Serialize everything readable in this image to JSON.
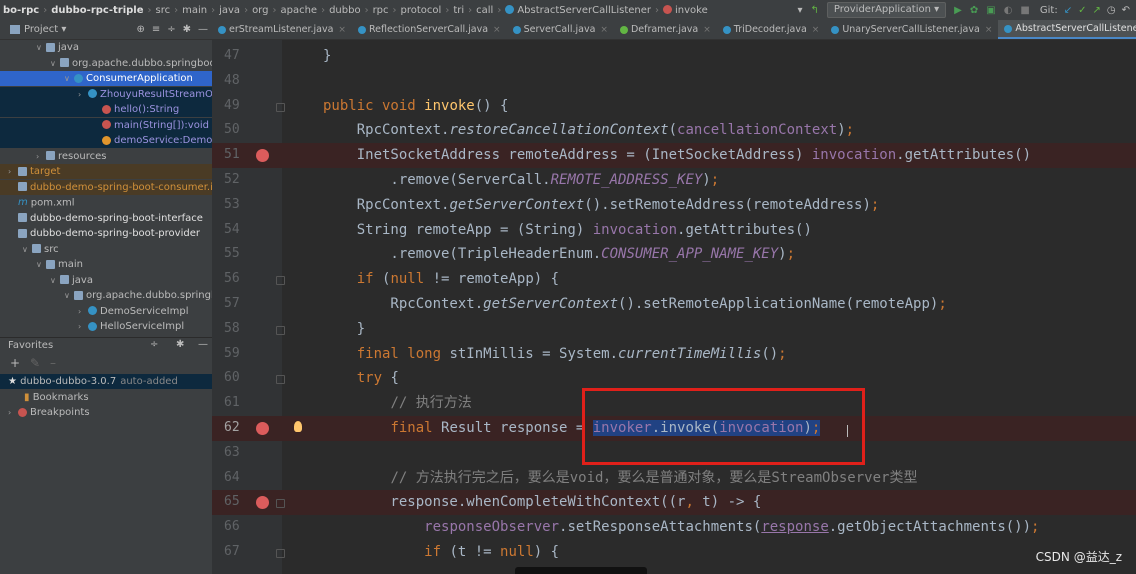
{
  "breadcrumb": [
    "bo-rpc",
    "dubbo-rpc-triple",
    "src",
    "main",
    "java",
    "org",
    "apache",
    "dubbo",
    "rpc",
    "protocol",
    "tri",
    "call",
    "AbstractServerCallListener",
    "invoke"
  ],
  "run_config": "ProviderApplication",
  "git_label": "Git:",
  "project_panel": {
    "label": "Project"
  },
  "tabs": [
    {
      "label": "erStreamListener.java",
      "color": "#3592c4",
      "active": false
    },
    {
      "label": "ReflectionServerCall.java",
      "color": "#3592c4",
      "active": false
    },
    {
      "label": "ServerCall.java",
      "color": "#3592c4",
      "active": false
    },
    {
      "label": "Deframer.java",
      "color": "#62b543",
      "active": false
    },
    {
      "label": "TriDecoder.java",
      "color": "#3592c4",
      "active": false
    },
    {
      "label": "UnaryServerCallListener.java",
      "color": "#3592c4",
      "active": false
    },
    {
      "label": "AbstractServerCallListener.java",
      "color": "#3592c4",
      "active": true
    }
  ],
  "tree": [
    {
      "label": "java",
      "indent": 36,
      "icon": "folder",
      "arrow": "v"
    },
    {
      "label": "org.apache.dubbo.springboo",
      "indent": 50,
      "icon": "folder",
      "arrow": "v"
    },
    {
      "label": "ConsumerApplication",
      "indent": 64,
      "icon": "class",
      "arrow": "v",
      "style": "selblue"
    },
    {
      "label": "ZhouyuResultStreamOb",
      "indent": 78,
      "icon": "class",
      "arrow": ">",
      "style": "sel"
    },
    {
      "label": "hello():String",
      "indent": 92,
      "icon": "red",
      "arrow": "",
      "style": "sel"
    },
    {
      "label": "main(String[]):void",
      "indent": 92,
      "icon": "red",
      "arrow": "",
      "style": "sel"
    },
    {
      "label": "demoService:DemoSen",
      "indent": 92,
      "icon": "orange",
      "arrow": "",
      "style": "sel"
    },
    {
      "label": "resources",
      "indent": 36,
      "icon": "folder",
      "arrow": ">"
    },
    {
      "label": "target",
      "indent": 8,
      "icon": "folder",
      "arrow": ">",
      "style": "orange"
    },
    {
      "label": "dubbo-demo-spring-boot-consumer.i",
      "indent": 8,
      "icon": "folder",
      "arrow": "",
      "style": "orange"
    },
    {
      "label": "pom.xml",
      "indent": 8,
      "icon": "pom",
      "arrow": ""
    },
    {
      "label": "dubbo-demo-spring-boot-interface",
      "indent": 8,
      "icon": "folder",
      "arrow": ""
    },
    {
      "label": "dubbo-demo-spring-boot-provider",
      "indent": 8,
      "icon": "folder",
      "arrow": ""
    },
    {
      "label": "src",
      "indent": 22,
      "icon": "folder",
      "arrow": "v"
    },
    {
      "label": "main",
      "indent": 36,
      "icon": "folder",
      "arrow": "v"
    },
    {
      "label": "java",
      "indent": 50,
      "icon": "folder",
      "arrow": "v"
    },
    {
      "label": "org.apache.dubbo.springboo",
      "indent": 64,
      "icon": "folder",
      "arrow": "v"
    },
    {
      "label": "DemoServiceImpl",
      "indent": 78,
      "icon": "class",
      "arrow": ">"
    },
    {
      "label": "HelloServiceImpl",
      "indent": 78,
      "icon": "class",
      "arrow": ">"
    }
  ],
  "favorites": {
    "label": "Favorites",
    "items": [
      {
        "label": "dubbo-dubbo-3.0.7",
        "suffix": "auto-added",
        "style": "sel",
        "icon": "star"
      },
      {
        "label": "Bookmarks",
        "style": "",
        "icon": "bookmark"
      },
      {
        "label": "Breakpoints",
        "style": "",
        "icon": "red"
      }
    ]
  },
  "code_lines": [
    {
      "n": "47",
      "html": "}"
    },
    {
      "n": "48",
      "html": ""
    },
    {
      "n": "49",
      "html": "<span class='kw'>public void </span><span class='fn'>invoke</span>() {",
      "fold": true
    },
    {
      "n": "50",
      "html": "    RpcContext.<span class='ital'>restoreCancellationContext</span>(<span class='fld'>cancellationContext</span>)<span class='kw'>;</span>"
    },
    {
      "n": "51",
      "html": "    InetSocketAddress remoteAddress = (InetSocketAddress) <span class='fld'>invocation</span>.getAttributes()",
      "bp": true
    },
    {
      "n": "52",
      "html": "        .remove(ServerCall.<span class='itfld'>REMOTE_ADDRESS_KEY</span>)<span class='kw'>;</span>"
    },
    {
      "n": "53",
      "html": "    RpcContext.<span class='ital'>getServerContext</span>().setRemoteAddress(remoteAddress)<span class='kw'>;</span>"
    },
    {
      "n": "54",
      "html": "    String remoteApp = (String) <span class='fld'>invocation</span>.getAttributes()"
    },
    {
      "n": "55",
      "html": "        .remove(TripleHeaderEnum.<span class='itfld'>CONSUMER_APP_NAME_KEY</span>)<span class='kw'>;</span>"
    },
    {
      "n": "56",
      "html": "    <span class='kw'>if </span>(<span class='kw'>null </span>!= remoteApp) {",
      "fold": true
    },
    {
      "n": "57",
      "html": "        RpcContext.<span class='ital'>getServerContext</span>().setRemoteApplicationName(remoteApp)<span class='kw'>;</span>"
    },
    {
      "n": "58",
      "html": "    }",
      "fold": true
    },
    {
      "n": "59",
      "html": "    <span class='kw'>final long </span>stInMillis = System.<span class='ital'>currentTimeMillis</span>()<span class='kw'>;</span>"
    },
    {
      "n": "60",
      "html": "    <span class='kw'>try </span>{",
      "fold": true
    },
    {
      "n": "61",
      "html": "        <span class='cm'>// 执行方法</span>"
    },
    {
      "n": "62",
      "html": "        <span class='kw'>final </span>Result response = <span class='sel-hl'><span class='fld'>invoker</span>.invoke(<span class='fld'>invocation</span>)</span><span class='kw sel-hl'>;</span>",
      "bp": true,
      "bulb": true,
      "current": true
    },
    {
      "n": "63",
      "html": ""
    },
    {
      "n": "64",
      "html": "        <span class='cm'>// 方法执行完之后，要么是void，要么是普通对象，要么是StreamObserver类型</span>"
    },
    {
      "n": "65",
      "html": "        response.whenCompleteWithContext((r<span class='kw'>, </span>t) -> {",
      "bp": true,
      "fold": true
    },
    {
      "n": "66",
      "html": "            <span class='fld'>responseObserver</span>.setResponseAttachments(<span class='fld u'>response</span>.getObjectAttachments())<span class='kw'>;</span>"
    },
    {
      "n": "67",
      "html": "            <span class='kw'>if </span>(t != <span class='kw'>null</span>) {",
      "fold": true
    }
  ],
  "watermark": "CSDN @益达_z"
}
